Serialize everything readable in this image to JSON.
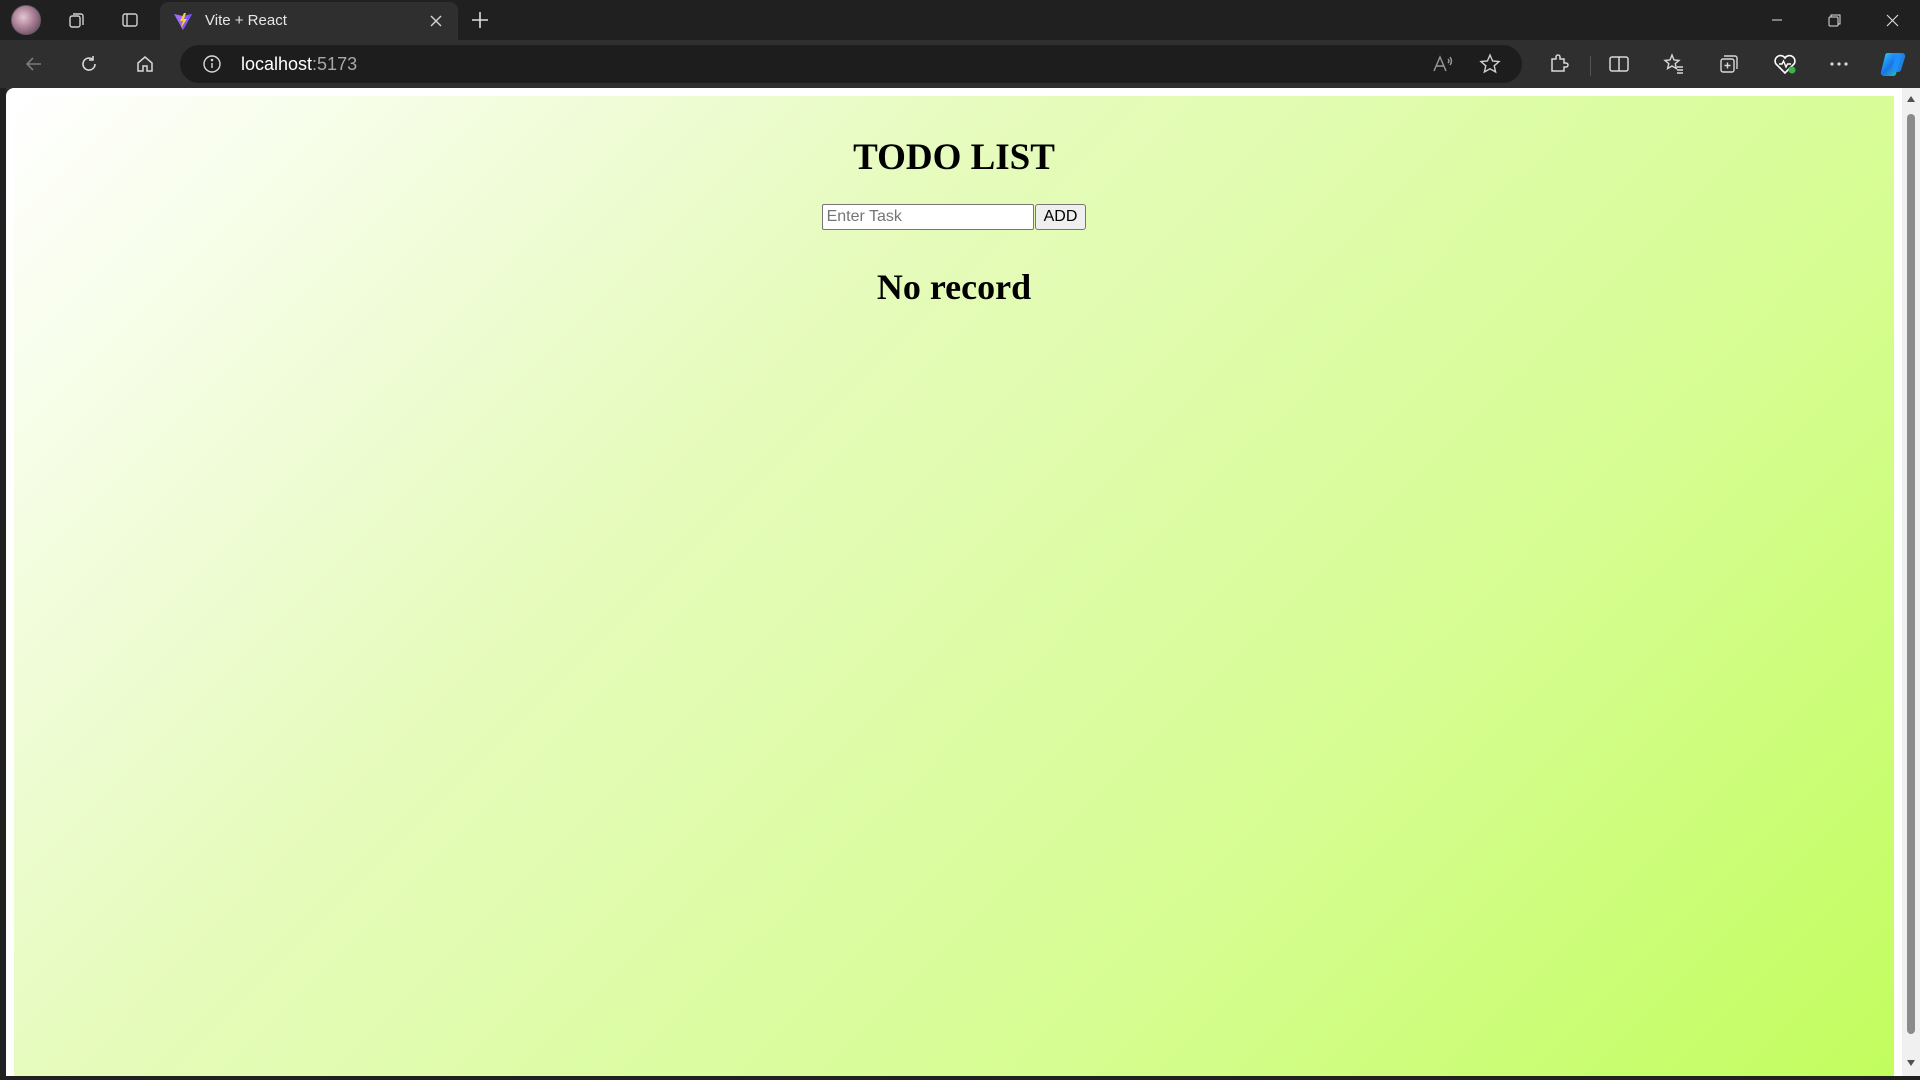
{
  "browser": {
    "tab": {
      "title": "Vite + React",
      "favicon": "vite-logo-icon"
    },
    "address": {
      "host": "localhost",
      "port": ":5173"
    },
    "colors": {
      "chrome_dark": "#202020",
      "toolbar": "#2f2f2f",
      "omnibox": "#1d1d1d"
    }
  },
  "app": {
    "title": "TODO LIST",
    "input": {
      "placeholder": "Enter Task",
      "value": ""
    },
    "add_button": "ADD",
    "empty_message": "No record",
    "background_gradient": [
      "#ffffff",
      "#c2fd5e"
    ]
  }
}
